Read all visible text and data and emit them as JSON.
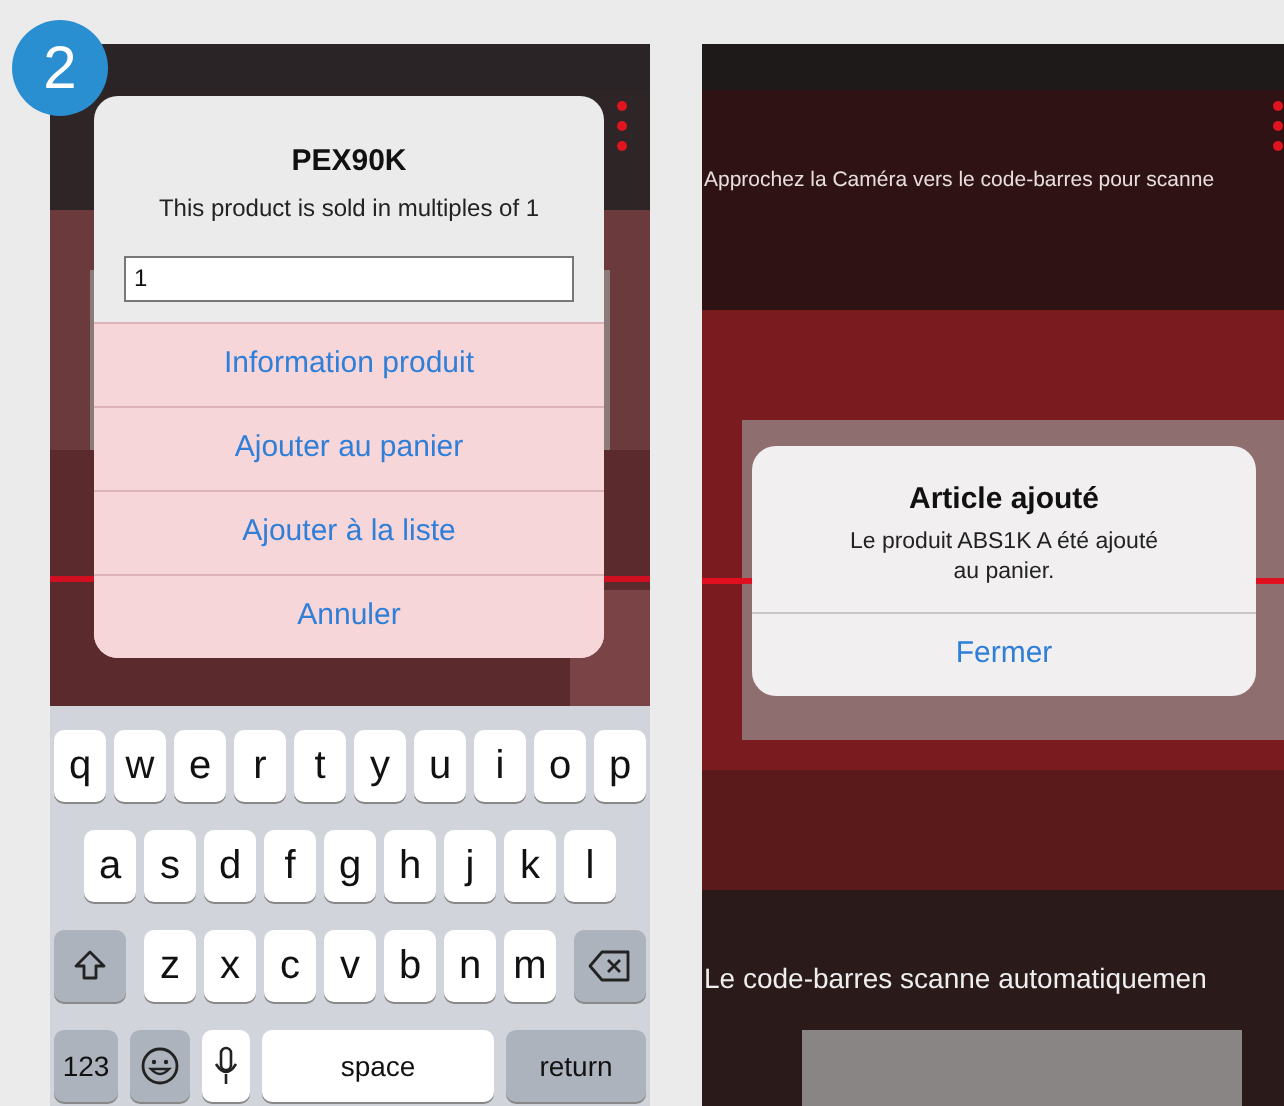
{
  "badge": "2",
  "left_screen": {
    "dialog": {
      "title": "PEX90K",
      "message": "This product is sold in multiples of 1",
      "quantity_value": "1",
      "actions": [
        "Information produit",
        "Ajouter au panier",
        "Ajouter à la liste",
        "Annuler"
      ]
    },
    "keyboard": {
      "letter_rows": [
        [
          {
            "kind": "letter",
            "label": "q"
          },
          {
            "kind": "letter",
            "label": "w"
          },
          {
            "kind": "letter",
            "label": "e"
          },
          {
            "kind": "letter",
            "label": "r"
          },
          {
            "kind": "letter",
            "label": "t"
          },
          {
            "kind": "letter",
            "label": "y"
          },
          {
            "kind": "letter",
            "label": "u"
          },
          {
            "kind": "letter",
            "label": "i"
          },
          {
            "kind": "letter",
            "label": "o"
          },
          {
            "kind": "letter",
            "label": "p"
          }
        ],
        [
          {
            "kind": "letter",
            "label": "a"
          },
          {
            "kind": "letter",
            "label": "s"
          },
          {
            "kind": "letter",
            "label": "d"
          },
          {
            "kind": "letter",
            "label": "f"
          },
          {
            "kind": "letter",
            "label": "g"
          },
          {
            "kind": "letter",
            "label": "h"
          },
          {
            "kind": "letter",
            "label": "j"
          },
          {
            "kind": "letter",
            "label": "k"
          },
          {
            "kind": "letter",
            "label": "l"
          }
        ],
        [
          {
            "kind": "shift"
          },
          {
            "kind": "letter",
            "label": "z"
          },
          {
            "kind": "letter",
            "label": "x"
          },
          {
            "kind": "letter",
            "label": "c"
          },
          {
            "kind": "letter",
            "label": "v"
          },
          {
            "kind": "letter",
            "label": "b"
          },
          {
            "kind": "letter",
            "label": "n"
          },
          {
            "kind": "letter",
            "label": "m"
          },
          {
            "kind": "delete"
          }
        ]
      ],
      "bottom_row": [
        {
          "kind": "numbers",
          "label": "123"
        },
        {
          "kind": "emoji"
        },
        {
          "kind": "mic"
        },
        {
          "kind": "space",
          "label": "space"
        },
        {
          "kind": "return",
          "label": "return"
        }
      ]
    }
  },
  "right_screen": {
    "hint_top": "Approchez la Caméra vers le code-barres pour scanne",
    "dialog": {
      "title": "Article ajouté",
      "message": "Le produit ABS1K A été ajouté au panier.",
      "actions": [
        "Fermer"
      ]
    },
    "hint_bottom": "Le code-barres scanne automatiquemen"
  }
}
